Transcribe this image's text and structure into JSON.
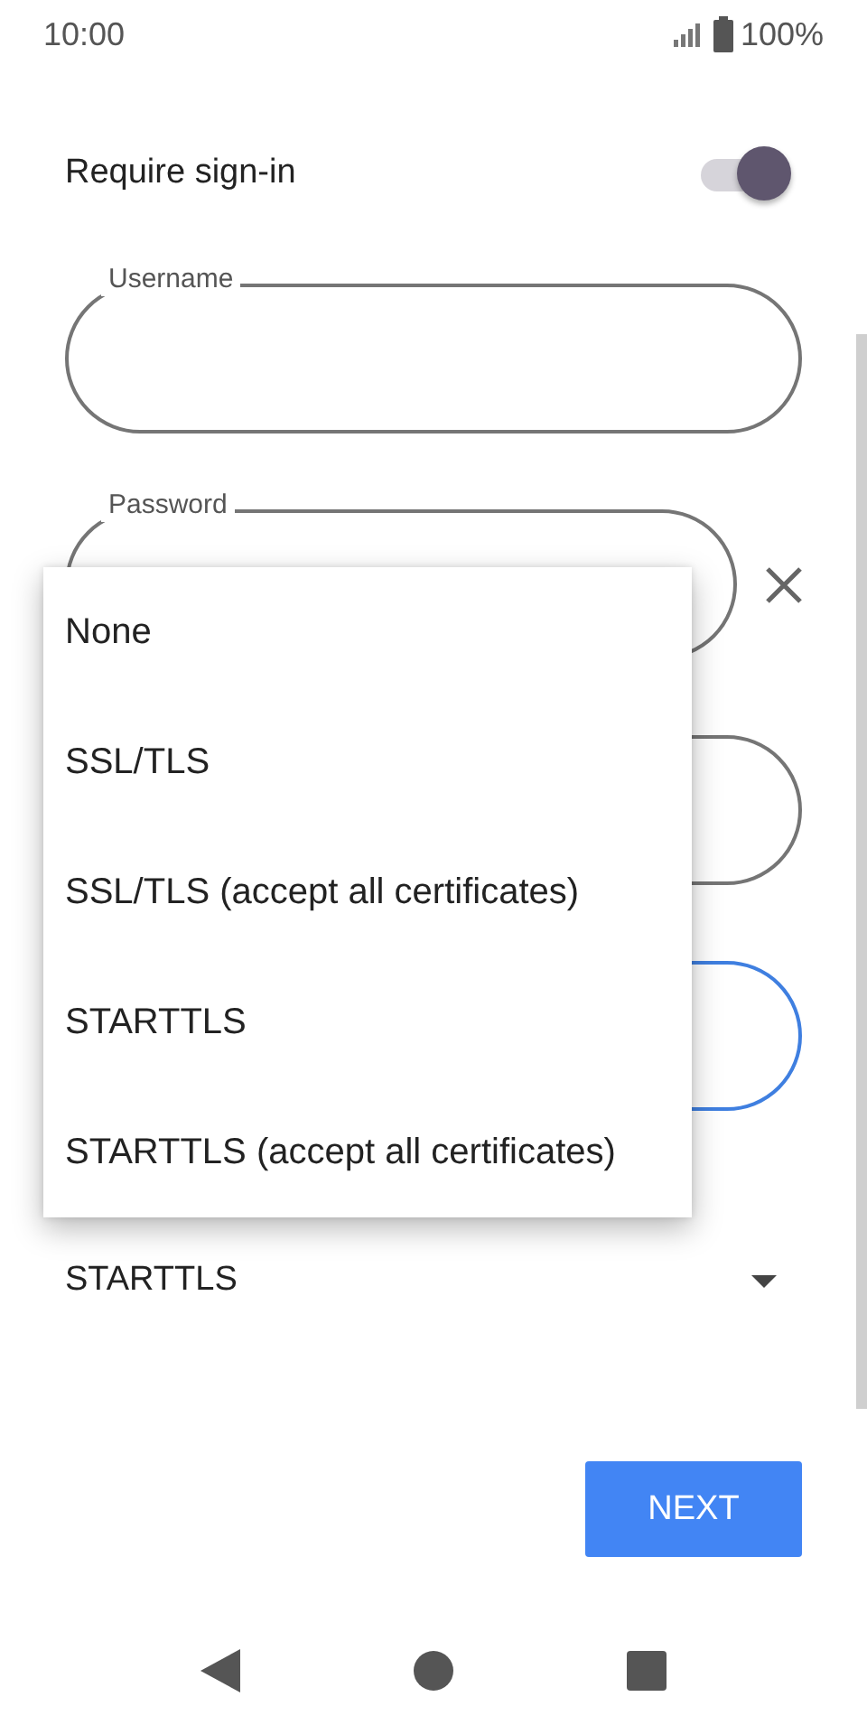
{
  "status_bar": {
    "time": "10:00",
    "battery": "100%"
  },
  "require_sign_in": {
    "label": "Require sign-in",
    "on": true
  },
  "fields": [
    {
      "kind": "text",
      "label": "Username",
      "focused": false
    },
    {
      "kind": "password",
      "label": "Password",
      "focused": false
    },
    {
      "kind": "text",
      "focused": false
    },
    {
      "kind": "text",
      "focused": true
    }
  ],
  "security_dropdown": {
    "value": "STARTTLS"
  },
  "menu": {
    "items": [
      {
        "label": "None"
      },
      {
        "label": "SSL/TLS"
      },
      {
        "label": "SSL/TLS (accept all certificates)"
      },
      {
        "label": "STARTTLS"
      },
      {
        "label": "STARTTLS (accept all certificates)"
      }
    ]
  },
  "next_button": {
    "label": "NEXT"
  }
}
